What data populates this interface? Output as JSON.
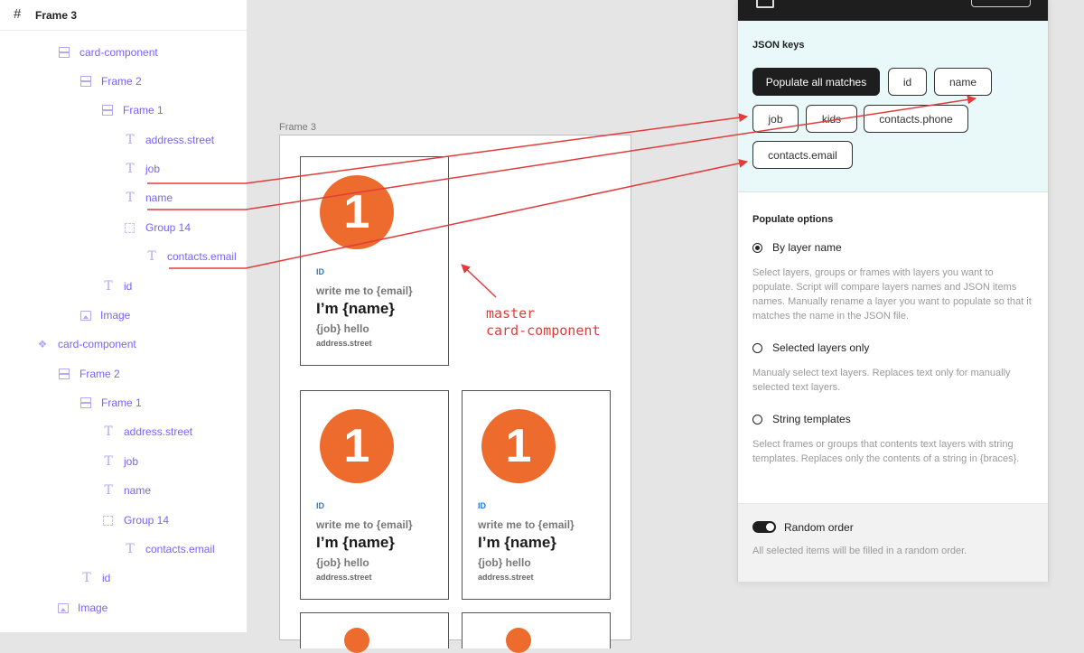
{
  "colors": {
    "accent_red": "#e33b3b",
    "layer_purple": "#7b61ff",
    "badge_orange": "#ec6b2d",
    "keys_bg": "#e9f8f8",
    "id_blue": "#1f7ae0"
  },
  "layers": {
    "header_icon": "#",
    "header_title": "Frame 3",
    "items": [
      {
        "label": "card-component",
        "icon": "auto-layout-icon"
      },
      {
        "label": "Frame 2",
        "icon": "auto-layout-icon"
      },
      {
        "label": "Frame 1",
        "icon": "auto-layout-icon"
      },
      {
        "label": "address.street",
        "icon": "text-icon"
      },
      {
        "label": "job",
        "icon": "text-icon"
      },
      {
        "label": "name",
        "icon": "text-icon"
      },
      {
        "label": "Group 14",
        "icon": "group-icon"
      },
      {
        "label": "contacts.email",
        "icon": "text-icon"
      },
      {
        "label": "id",
        "icon": "text-icon"
      },
      {
        "label": "Image",
        "icon": "image-icon"
      },
      {
        "label": "card-component",
        "icon": "component-icon"
      },
      {
        "label": "Frame 2",
        "icon": "auto-layout-icon"
      },
      {
        "label": "Frame 1",
        "icon": "auto-layout-icon"
      },
      {
        "label": "address.street",
        "icon": "text-icon"
      },
      {
        "label": "job",
        "icon": "text-icon"
      },
      {
        "label": "name",
        "icon": "text-icon"
      },
      {
        "label": "Group 14",
        "icon": "group-icon"
      },
      {
        "label": "contacts.email",
        "icon": "text-icon"
      },
      {
        "label": "id",
        "icon": "text-icon"
      },
      {
        "label": "Image",
        "icon": "image-icon"
      }
    ]
  },
  "canvas": {
    "frame_label": "Frame 3",
    "card": {
      "badge": "1",
      "id": "ID",
      "email": "write me to {email}",
      "name": "I’m {name}",
      "job": "{job} hello",
      "street": "address.street"
    },
    "master_label_line1": "master",
    "master_label_line2": "card-component"
  },
  "plugin": {
    "keys_title": "JSON keys",
    "keys": {
      "populate_all": "Populate all matches",
      "id": "id",
      "name": "name",
      "job": "job",
      "kids": "kids",
      "contacts_phone": "contacts.phone",
      "contacts_email": "contacts.email"
    },
    "options_title": "Populate options",
    "options": [
      {
        "label": "By layer name",
        "checked": true,
        "desc": "Select layers, groups or frames with layers you want to populate. Script will compare layers names and JSON items names. Manually rename a layer you want to populate so that it matches the name in the JSON file."
      },
      {
        "label": "Selected layers only",
        "checked": false,
        "desc": "Manualy select text layers. Replaces text only for manually selected text layers."
      },
      {
        "label": "String templates",
        "checked": false,
        "desc": "Select frames or groups that contents text layers with string templates. Replaces only the contents of a string in {braces}."
      }
    ],
    "random": {
      "label": "Random order",
      "enabled": true,
      "desc": "All selected items will be filled in a random order."
    }
  }
}
